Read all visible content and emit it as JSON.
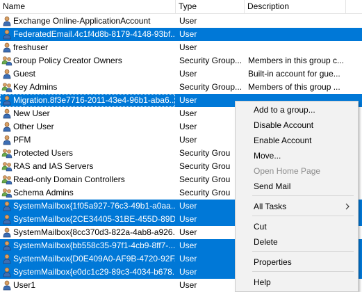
{
  "columns": {
    "name": "Name",
    "type": "Type",
    "description": "Description"
  },
  "rows": [
    {
      "name": "Exchange Online-ApplicationAccount",
      "type": "User",
      "description": "",
      "icon": "user-icon",
      "selected": false
    },
    {
      "name": "FederatedEmail.4c1f4d8b-8179-4148-93bf...",
      "type": "User",
      "description": "",
      "icon": "user-icon",
      "selected": true
    },
    {
      "name": "freshuser",
      "type": "User",
      "description": "",
      "icon": "user-icon",
      "selected": false
    },
    {
      "name": "Group Policy Creator Owners",
      "type": "Security Group...",
      "description": "Members in this group c...",
      "icon": "group-icon",
      "selected": false
    },
    {
      "name": "Guest",
      "type": "User",
      "description": "Built-in account for gue...",
      "icon": "user-icon",
      "selected": false
    },
    {
      "name": "Key Admins",
      "type": "Security Group...",
      "description": "Members of this group ...",
      "icon": "group-icon",
      "selected": false
    },
    {
      "name": "Migration.8f3e7716-2011-43e4-96b1-aba6...",
      "type": "User",
      "description": "",
      "icon": "user-icon",
      "selected": true
    },
    {
      "name": "New User",
      "type": "User",
      "description": "",
      "icon": "user-icon",
      "selected": false
    },
    {
      "name": "Other User",
      "type": "User",
      "description": "",
      "icon": "user-icon",
      "selected": false
    },
    {
      "name": "PFM",
      "type": "User",
      "description": "",
      "icon": "user-icon",
      "selected": false
    },
    {
      "name": "Protected Users",
      "type": "Security Grou",
      "description": "",
      "icon": "group-icon",
      "selected": false
    },
    {
      "name": "RAS and IAS Servers",
      "type": "Security Grou",
      "description": "",
      "icon": "group-icon",
      "selected": false
    },
    {
      "name": "Read-only Domain Controllers",
      "type": "Security Grou",
      "description": "",
      "icon": "group-icon",
      "selected": false
    },
    {
      "name": "Schema Admins",
      "type": "Security Grou",
      "description": "",
      "icon": "group-icon",
      "selected": false
    },
    {
      "name": "SystemMailbox{1f05a927-76c3-49b1-a0aa...",
      "type": "User",
      "description": "",
      "icon": "user-icon",
      "selected": true
    },
    {
      "name": "SystemMailbox{2CE34405-31BE-455D-89D...",
      "type": "User",
      "description": "",
      "icon": "user-icon",
      "selected": true
    },
    {
      "name": "SystemMailbox{8cc370d3-822a-4ab8-a926...",
      "type": "User",
      "description": "",
      "icon": "user-icon",
      "selected": false
    },
    {
      "name": "SystemMailbox{bb558c35-97f1-4cb9-8ff7-...",
      "type": "User",
      "description": "",
      "icon": "user-icon",
      "selected": true
    },
    {
      "name": "SystemMailbox{D0E409A0-AF9B-4720-92F...",
      "type": "User",
      "description": "",
      "icon": "user-icon",
      "selected": true
    },
    {
      "name": "SystemMailbox{e0dc1c29-89c3-4034-b678...",
      "type": "User",
      "description": "",
      "icon": "user-icon",
      "selected": true
    },
    {
      "name": "User1",
      "type": "User",
      "description": "",
      "icon": "user-icon",
      "selected": false
    }
  ],
  "context_menu": {
    "add_to_group": "Add to a group...",
    "disable_account": "Disable Account",
    "enable_account": "Enable Account",
    "move": "Move...",
    "open_home_page": "Open Home Page",
    "send_mail": "Send Mail",
    "all_tasks": "All Tasks",
    "cut": "Cut",
    "delete": "Delete",
    "properties": "Properties",
    "help": "Help"
  },
  "colors": {
    "selection": "#0078d7",
    "menu_bg": "#f2f2f2",
    "disabled_text": "#8c8c8c"
  }
}
